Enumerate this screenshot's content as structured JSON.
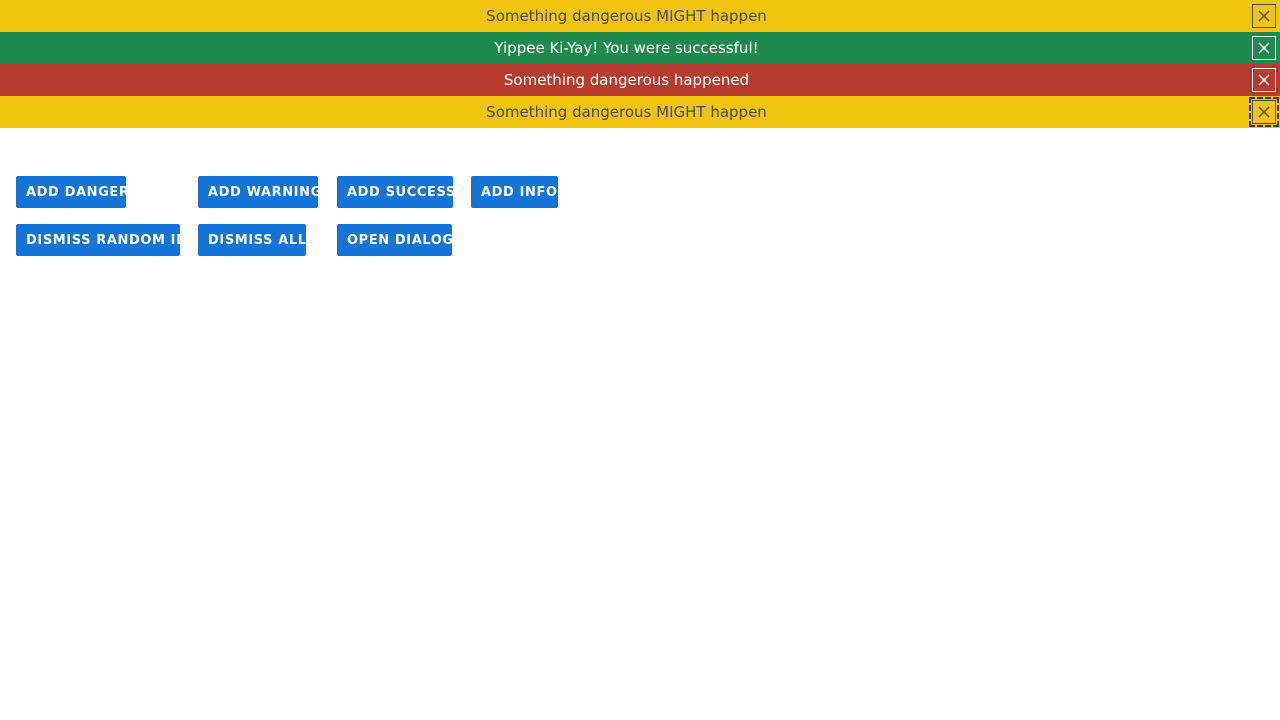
{
  "alerts": [
    {
      "type": "warning",
      "message": "Something dangerous MIGHT happen"
    },
    {
      "type": "success",
      "message": "Yippee Ki-Yay! You were successful!"
    },
    {
      "type": "danger",
      "message": "Something dangerous happened"
    },
    {
      "type": "warning",
      "message": "Something dangerous MIGHT happen"
    }
  ],
  "colors": {
    "warning": "#f1c40f",
    "success": "#1e8b4c",
    "danger": "#b83c2e",
    "button": "#1474d8"
  },
  "buttons": {
    "add_danger": "ADD DANGER",
    "add_warning": "ADD WARNING",
    "add_success": "ADD SUCCESS",
    "add_info": "ADD INFO",
    "dismiss_random": "DISMISS RANDOM ID",
    "dismiss_all": "DISMISS ALL",
    "open_dialog": "OPEN DIALOG"
  },
  "icons": {
    "close": "close-icon"
  }
}
